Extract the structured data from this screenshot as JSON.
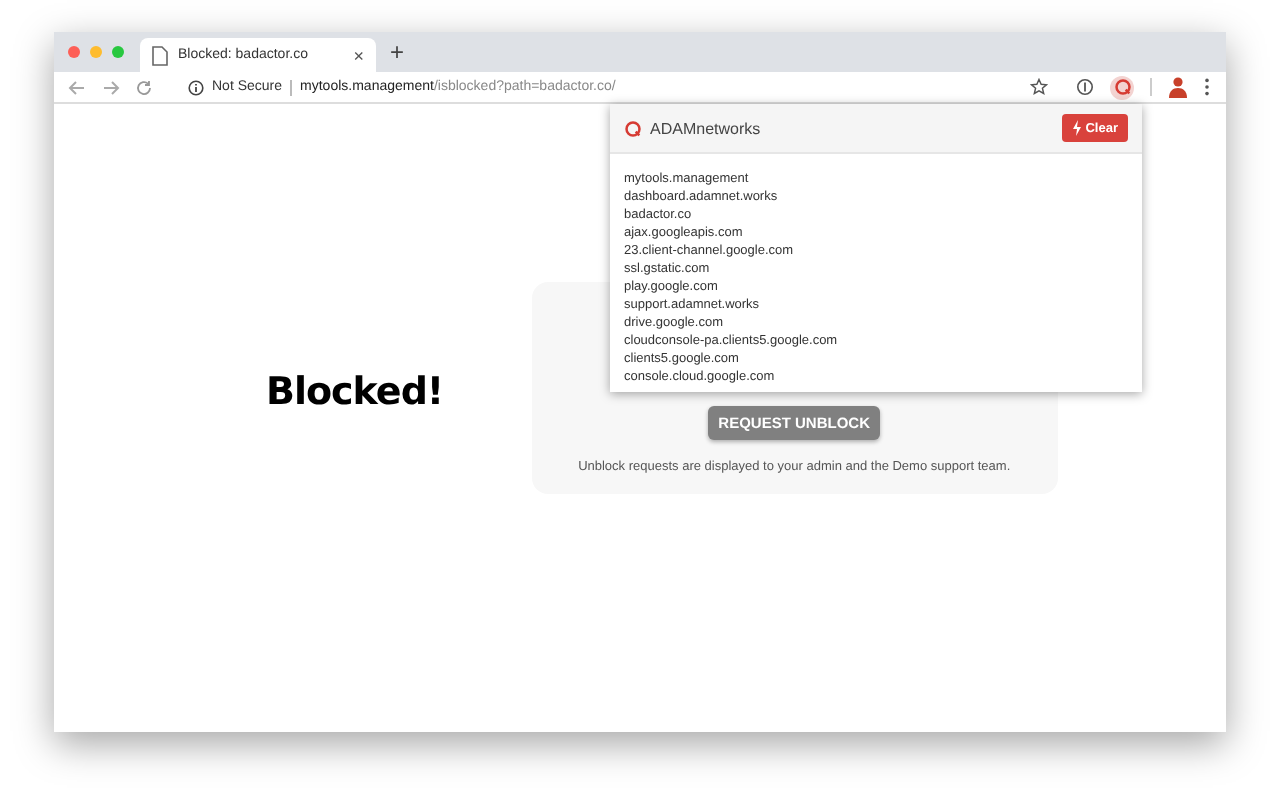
{
  "tab": {
    "title": "Blocked: badactor.co",
    "close": "×",
    "new_tab": "+"
  },
  "address_bar": {
    "security": "Not Secure",
    "host": "mytools.management",
    "path": "/isblocked?path=badactor.co/"
  },
  "page": {
    "heading": "Blocked!",
    "button": "REQUEST UNBLOCK",
    "note": "Unblock requests are displayed to your admin and the Demo support team."
  },
  "popup": {
    "title": "ADAMnetworks",
    "clear_button": "Clear",
    "domains": [
      "mytools.management",
      "dashboard.adamnet.works",
      "badactor.co",
      "ajax.googleapis.com",
      "23.client-channel.google.com",
      "ssl.gstatic.com",
      "play.google.com",
      "support.adamnet.works",
      "drive.google.com",
      "cloudconsole-pa.clients5.google.com",
      "clients5.google.com",
      "console.cloud.google.com"
    ]
  }
}
